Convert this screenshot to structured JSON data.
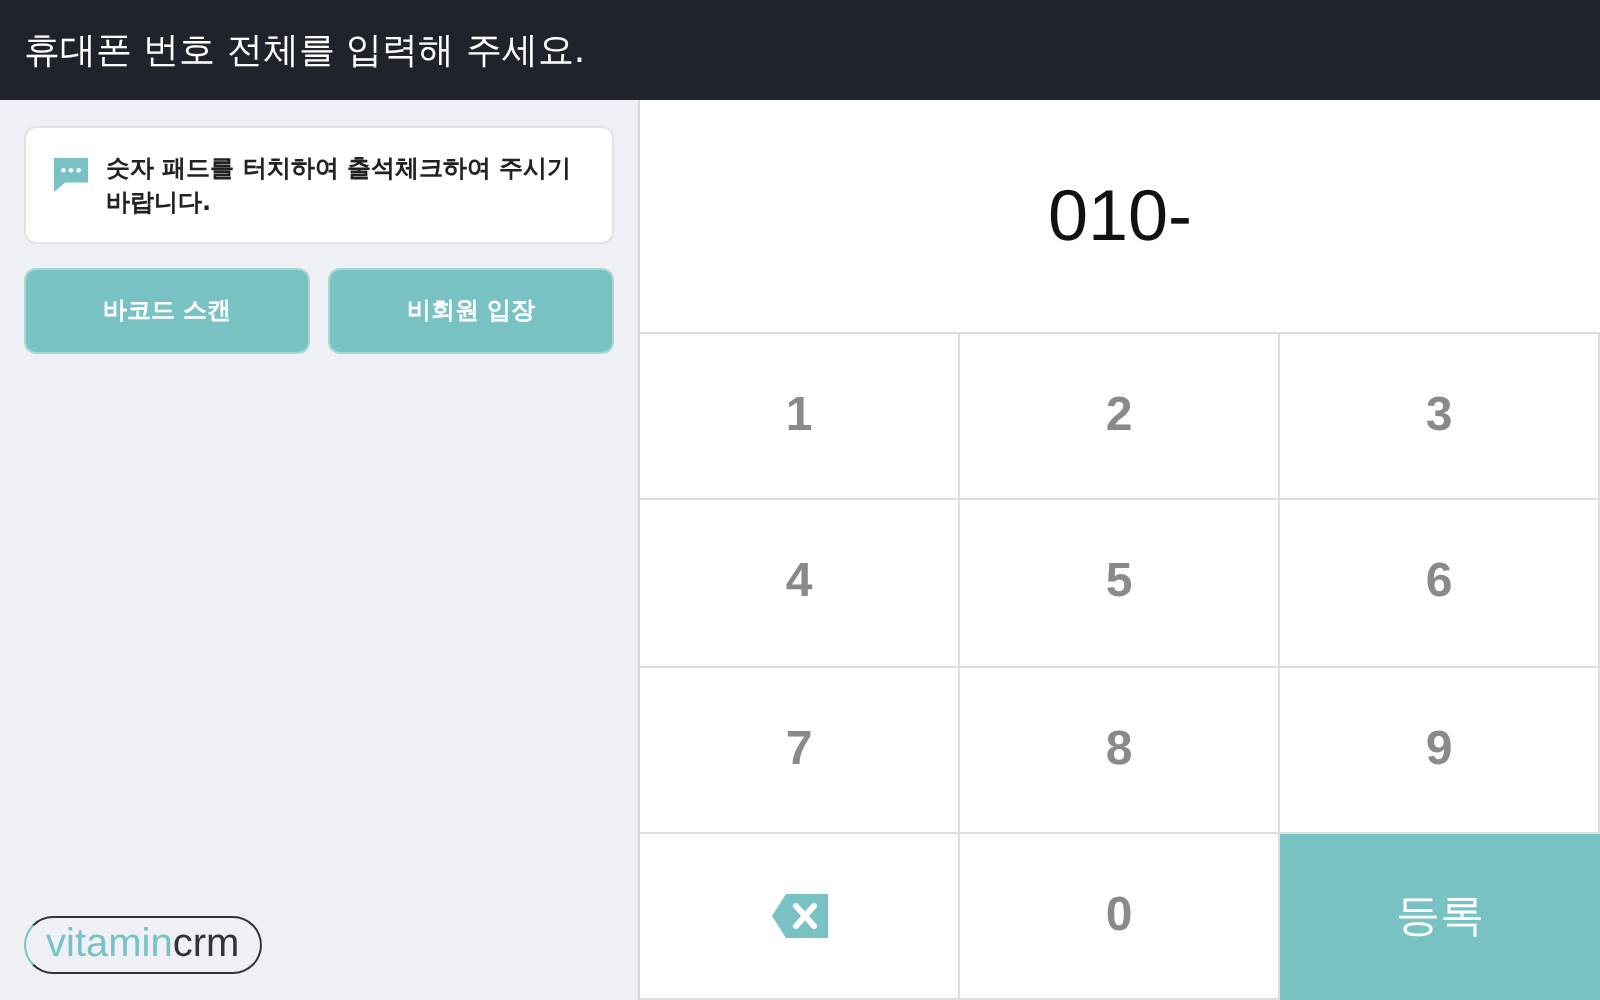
{
  "header": {
    "title": "휴대폰 번호 전체를 입력해 주세요."
  },
  "notice": {
    "text": "숫자 패드를 터치하여 출석체크하여 주시기 바랍니다."
  },
  "buttons": [
    "바코드 스캔",
    "비회원 입장"
  ],
  "logo": {
    "brand": "vitamin",
    "product": "crm"
  },
  "display": {
    "value": "010-"
  },
  "keys": [
    {
      "kind": "digit",
      "label": "1"
    },
    {
      "kind": "digit",
      "label": "2"
    },
    {
      "kind": "digit",
      "label": "3"
    },
    {
      "kind": "digit",
      "label": "4"
    },
    {
      "kind": "digit",
      "label": "5"
    },
    {
      "kind": "digit",
      "label": "6"
    },
    {
      "kind": "digit",
      "label": "7"
    },
    {
      "kind": "digit",
      "label": "8"
    },
    {
      "kind": "digit",
      "label": "9"
    },
    {
      "kind": "backspace"
    },
    {
      "kind": "digit",
      "label": "0"
    },
    {
      "kind": "submit",
      "label": "등록"
    }
  ]
}
